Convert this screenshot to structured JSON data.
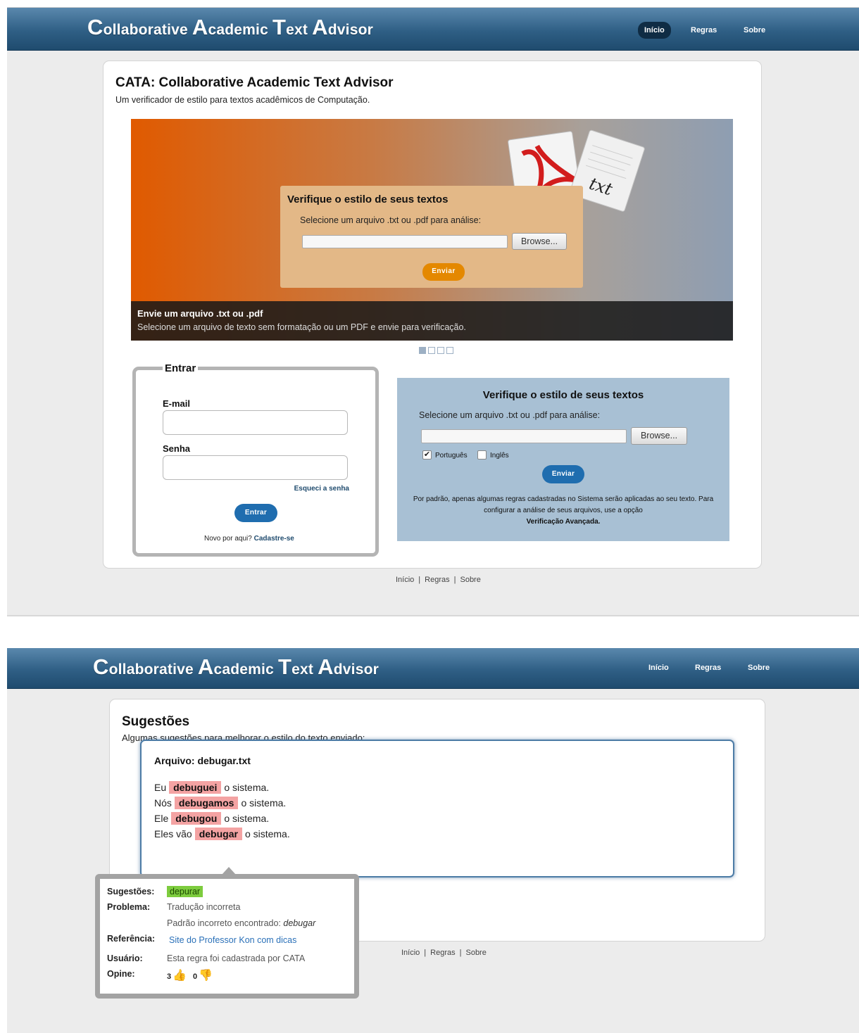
{
  "brand": {
    "words": [
      {
        "initial": "C",
        "rest": "ollaborative"
      },
      {
        "initial": "A",
        "rest": "cademic"
      },
      {
        "initial": "T",
        "rest": "ext"
      },
      {
        "initial": "A",
        "rest": "dvisor"
      }
    ]
  },
  "nav": {
    "inicio": "Início",
    "regras": "Regras",
    "sobre": "Sobre"
  },
  "home": {
    "title": "CATA: Collaborative Academic Text Advisor",
    "subtitle": "Um verificador de estilo para textos acadêmicos de Computação.",
    "banner": {
      "box_title": "Verifique o estilo de seus textos",
      "box_label": "Selecione um arquivo .txt ou .pdf para análise:",
      "browse": "Browse...",
      "submit": "Enviar",
      "pdf_icon_label": "pdf-file-icon",
      "txt_icon_label": "txt",
      "caption_title": "Envie um arquivo .txt ou .pdf",
      "caption_text": "Selecione um arquivo de texto sem formatação ou um PDF e envie para verificação.",
      "slide_count": 4,
      "active_slide": 1
    },
    "login": {
      "legend": "Entrar",
      "email_label": "E-mail",
      "password_label": "Senha",
      "forgot": "Esqueci a senha",
      "submit": "Entrar",
      "new_user_text": "Novo por aqui?",
      "signup_link": "Cadastre-se"
    },
    "verify": {
      "title": "Verifique o estilo de seus textos",
      "label": "Selecione um arquivo .txt ou .pdf para análise:",
      "browse": "Browse...",
      "lang_pt": "Português",
      "lang_pt_checked": true,
      "lang_en": "Inglês",
      "lang_en_checked": false,
      "submit": "Enviar",
      "note": "Por padrão, apenas algumas regras cadastradas no Sistema serão aplicadas ao seu texto. Para configurar a análise de seus arquivos, use a opção",
      "note_link": "Verificação Avançada."
    }
  },
  "footer": {
    "inicio": "Início",
    "regras": "Regras",
    "sobre": "Sobre",
    "separator": "|"
  },
  "results": {
    "title": "Sugestões",
    "subtitle": "Algumas sugestões para melhorar o estilo do texto enviado:",
    "file_heading": "Arquivo: debugar.txt",
    "lines": [
      {
        "before": "Eu",
        "word": "debuguei",
        "after": "o sistema."
      },
      {
        "before": "Nós",
        "word": "debugamos",
        "after": "o sistema."
      },
      {
        "before": "Ele",
        "word": "debugou",
        "after": "o sistema."
      },
      {
        "before": "Eles vão",
        "word": "debugar",
        "after": "o sistema."
      }
    ],
    "tooltip": {
      "suggestions_key": "Sugestões:",
      "suggestion": "depurar",
      "problem_key": "Problema:",
      "problem": "Tradução incorreta",
      "pattern_text": "Padrão incorreto encontrado:",
      "pattern_word": "debugar",
      "reference_key": "Referência:",
      "reference_link": "Site do Professor Kon com dicas",
      "user_key": "Usuário:",
      "user_text": "Esta regra foi cadastrada por CATA",
      "vote_key": "Opine:",
      "upvotes": "3",
      "downvotes": "0",
      "up_icon": "thumbs-up-icon",
      "down_icon": "thumbs-down-icon"
    }
  }
}
